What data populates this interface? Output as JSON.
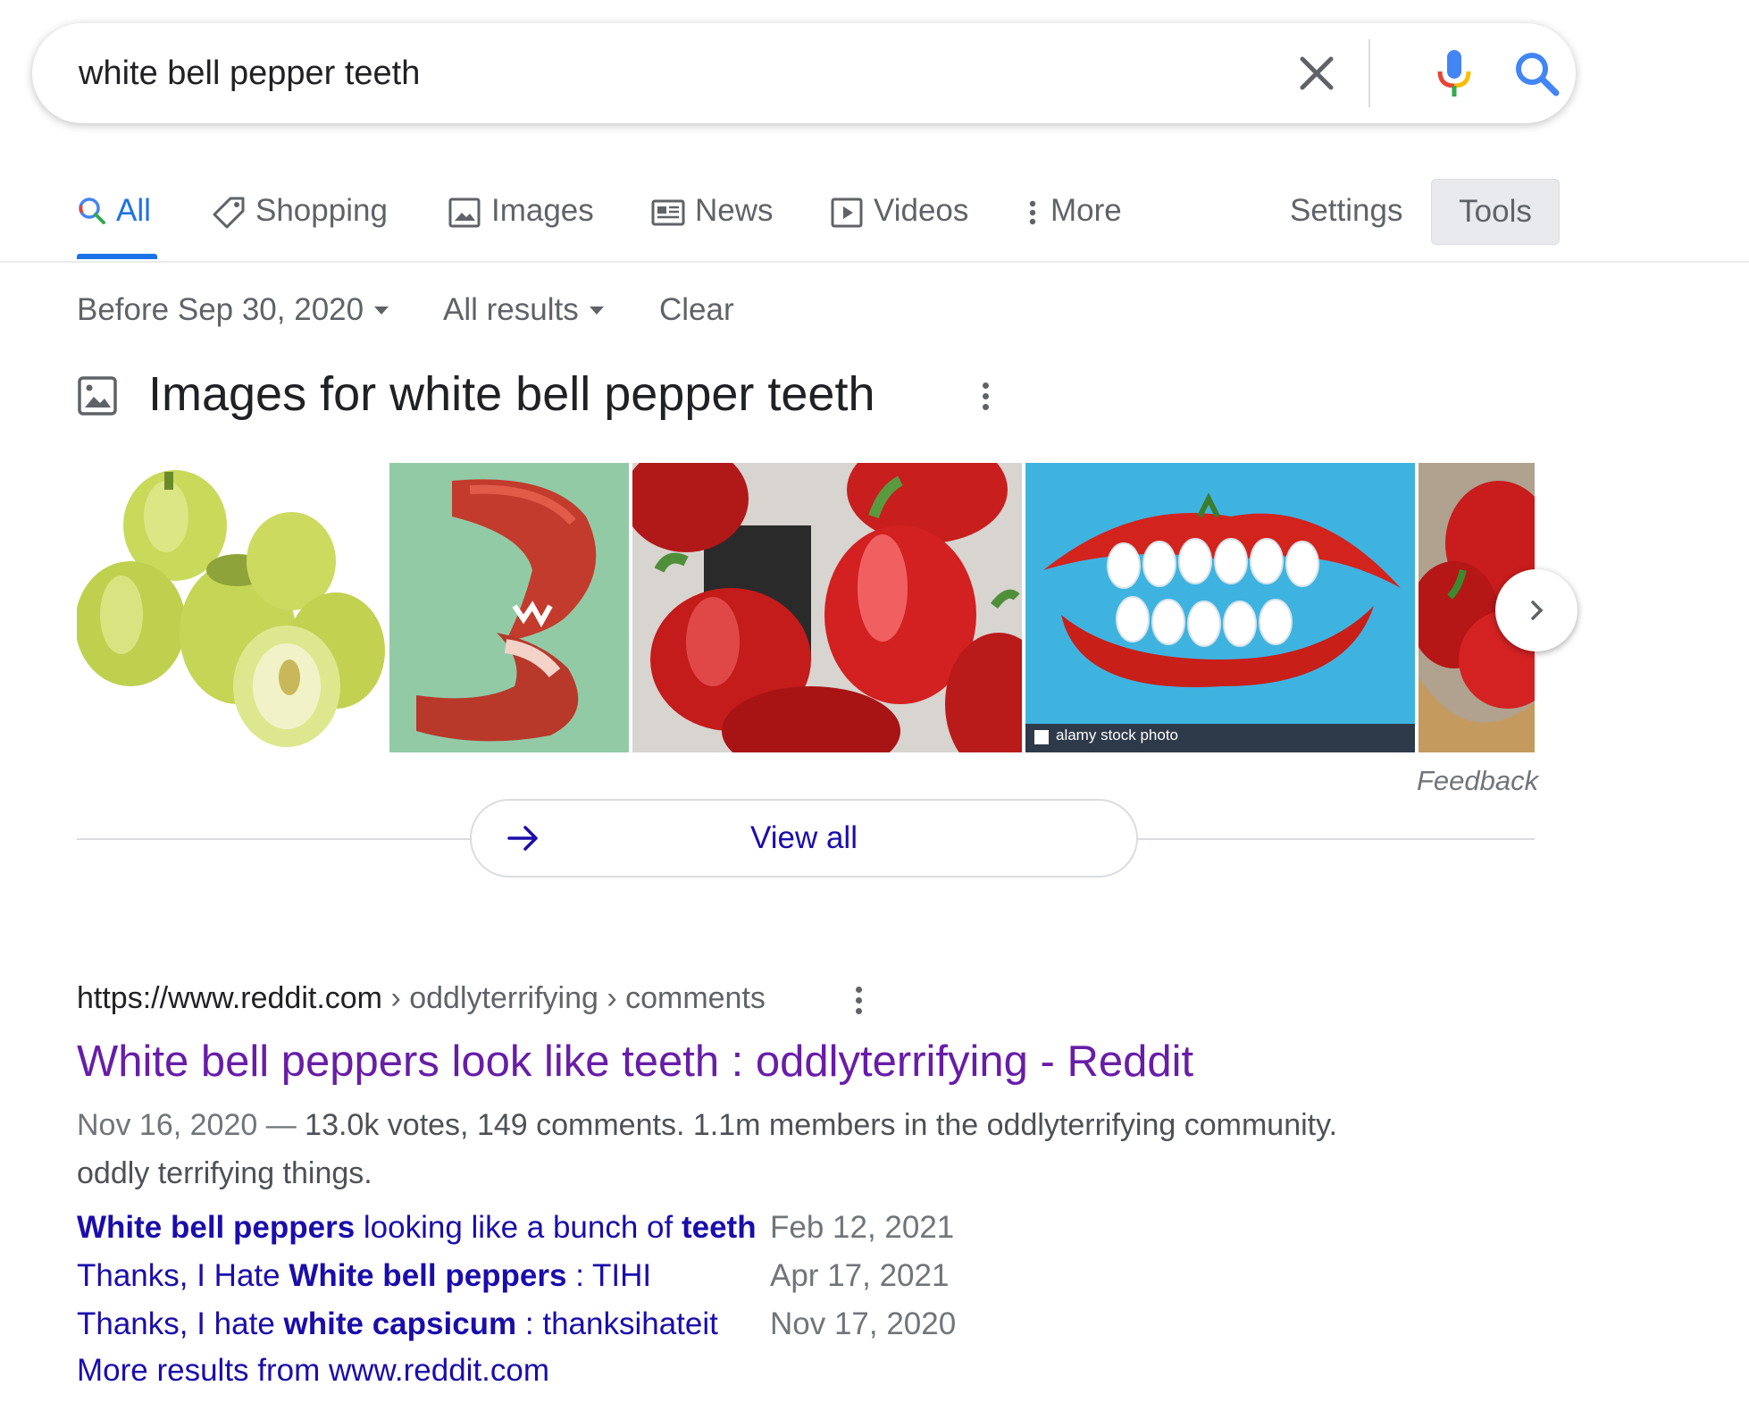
{
  "search": {
    "query": "white bell pepper teeth"
  },
  "tabs": [
    {
      "label": "All",
      "icon": "search-icon",
      "active": true
    },
    {
      "label": "Shopping",
      "icon": "tag-icon"
    },
    {
      "label": "Images",
      "icon": "image-icon"
    },
    {
      "label": "News",
      "icon": "news-icon"
    },
    {
      "label": "Videos",
      "icon": "video-icon"
    },
    {
      "label": "More",
      "icon": "more-vert-icon"
    }
  ],
  "toolbar": {
    "settings_label": "Settings",
    "tools_label": "Tools"
  },
  "filters": {
    "time": "Before Sep 30, 2020",
    "results": "All results",
    "clear": "Clear"
  },
  "images_section": {
    "heading": "Images for white bell pepper teeth",
    "thumbnails": [
      {
        "subject": "pale yellow-green bell peppers"
      },
      {
        "subject": "red pepper slice shaped like mouth"
      },
      {
        "subject": "red bell peppers close-up"
      },
      {
        "subject": "chili pepper lips with egg teeth",
        "watermark": "alamy stock photo"
      },
      {
        "subject": "red peppers in bowl"
      }
    ],
    "feedback": "Feedback",
    "view_all": "View all"
  },
  "result": {
    "url_host": "https://www.reddit.com",
    "url_path": " › oddlyterrifying › comments",
    "title": "White bell peppers look like teeth : oddlyterrifying - Reddit",
    "date": "Nov 16, 2020",
    "snippet_dash": " — ",
    "snippet_line1": "13.0k votes, 149 comments. 1.1m members in the oddlyterrifying community.",
    "snippet_line2": "oddly terrifying things.",
    "sitelinks": [
      {
        "b1": "White bell peppers",
        "t1": " looking like a bunch of ",
        "b2": "teeth",
        "t2": "",
        "date": "Feb 12, 2021"
      },
      {
        "b1": "",
        "t1": "Thanks, I Hate ",
        "b2": "White bell peppers",
        "t2": " : TIHI",
        "date": "Apr 17, 2021"
      },
      {
        "b1": "",
        "t1": "Thanks, I hate ",
        "b2": "white capsicum",
        "t2": " : thanksihateit",
        "date": "Nov 17, 2020"
      }
    ],
    "more_from": "More results from www.reddit.com"
  },
  "colors": {
    "link_blue": "#1a0dab",
    "visited_purple": "#681da8",
    "accent_blue": "#1a73e8",
    "secondary_text": "#5f6368"
  }
}
